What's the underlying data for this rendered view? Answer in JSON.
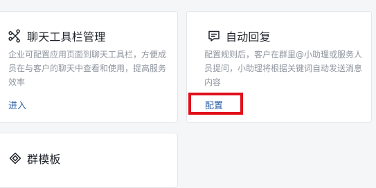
{
  "cards": [
    {
      "id": "chat-toolbar",
      "icon": "toolbar-icon",
      "title": "聊天工具栏管理",
      "description": "企业可配置应用页面到聊天工具栏，方便成员在与客户的聊天中查看和使用，提高服务效率",
      "action": "进入"
    },
    {
      "id": "auto-reply",
      "icon": "message-reply-icon",
      "title": "自动回复",
      "description": "配置规则后，客户在群里@小助理或服务人员提问，小助理将根据关键词自动发送消息内容",
      "action": "配置"
    },
    {
      "id": "group-template",
      "icon": "group-template-icon",
      "title": "群模板"
    }
  ],
  "highlight": {
    "target": "auto-reply-configure-link",
    "color": "#e0111b"
  }
}
